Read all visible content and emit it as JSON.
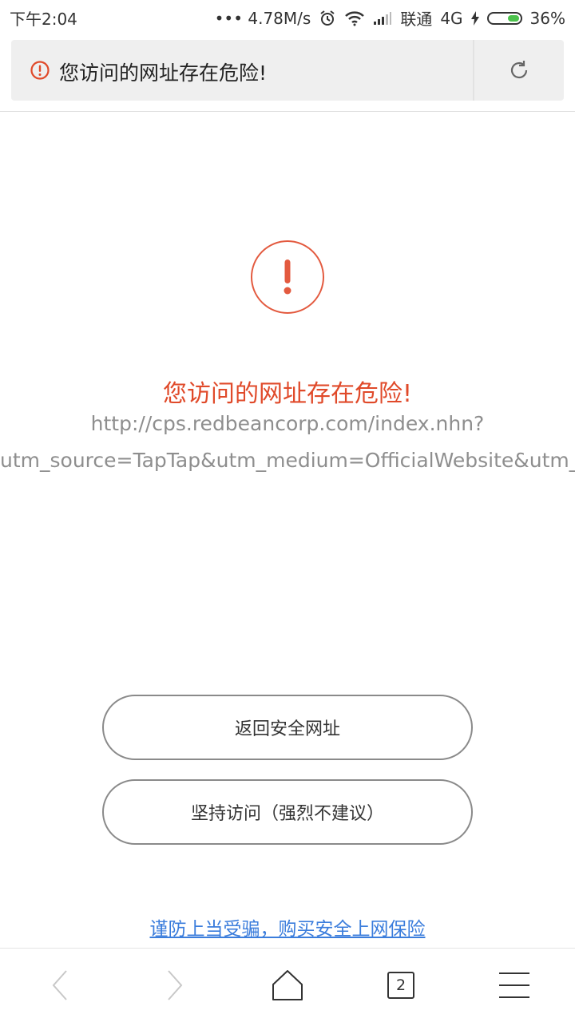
{
  "status_bar": {
    "time": "下午2:04",
    "net_speed": "••• 4.78M/s",
    "carrier": "联通",
    "network": "4G",
    "battery": "36%",
    "icons": [
      "alarm-icon",
      "wifi-icon",
      "signal-icon",
      "charging-icon",
      "battery-icon"
    ]
  },
  "address_bar": {
    "text": "您访问的网址存在危险!",
    "icons": [
      "warning-icon",
      "reload-icon"
    ]
  },
  "warning": {
    "title": "您访问的网址存在危险!",
    "url_line1": "http://cps.redbeancorp.com/index.nhn?",
    "url_line2": "utm_source=TapTap&utm_medium=OfficialWebsite&utm_c",
    "accent_color": "#e04a2a"
  },
  "buttons": {
    "back_label": "返回安全网址",
    "continue_label": "坚持访问（强烈不建议）"
  },
  "insurance_link": "谨防上当受骗，购买安全上网保险",
  "bottom_nav": {
    "tab_count": "2",
    "icons": [
      "back-arrow-icon",
      "forward-arrow-icon",
      "home-icon",
      "tabs-icon",
      "menu-icon"
    ]
  }
}
